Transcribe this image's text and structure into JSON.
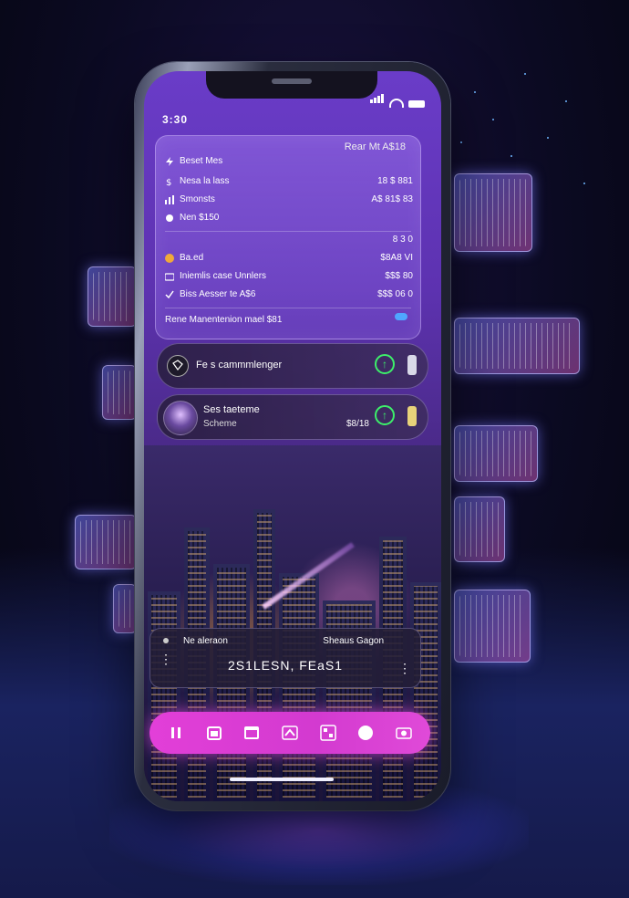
{
  "status_bar": {
    "time": "3:30"
  },
  "summary_card": {
    "header_right": "Rear Mt A$18",
    "rows": [
      {
        "icon": "bolt-icon",
        "label": "Beset Mes",
        "value": ""
      },
      {
        "icon": "dollar-icon",
        "label": "Nesa la lass",
        "value": "18 $ 881"
      },
      {
        "icon": "bars-icon",
        "label": "Smonsts",
        "value": "A$ 81$ 83"
      },
      {
        "icon": "circle-icon",
        "label": "Nen $150",
        "value": ""
      },
      {
        "icon": "toggle-icon",
        "label": "",
        "value": "8 3 0"
      },
      {
        "icon": "coin-icon",
        "label": "Ba.ed",
        "value": "$8A8 VI"
      },
      {
        "icon": "wallet-icon",
        "label": "Iniemlis case Unnlers",
        "value": "$$$ 80"
      },
      {
        "icon": "check-icon",
        "label": "Biss Aesser te A$6",
        "value": "$$$ 06 0"
      }
    ],
    "footer": "Rene Manentenion mael $81"
  },
  "notifications": [
    {
      "title": "Fe s cammmlenger",
      "subtitle": "",
      "amount": ""
    },
    {
      "title": "Ses taeteme",
      "subtitle": "Scheme",
      "amount": "$8/18"
    }
  ],
  "widget": {
    "left_label": "Ne aleraon",
    "right_label": "Sheaus Gagon",
    "big_value": "2S1LESN, FEaS1"
  },
  "dock": {
    "icons": [
      "pause-icon",
      "calendar-icon",
      "browser-icon",
      "chevron-up-icon",
      "grid-icon",
      "record-icon",
      "camera-icon"
    ]
  },
  "colors": {
    "accent": "#e23fd8",
    "screen_top": "#6a3cc8",
    "success": "#3df06a"
  }
}
